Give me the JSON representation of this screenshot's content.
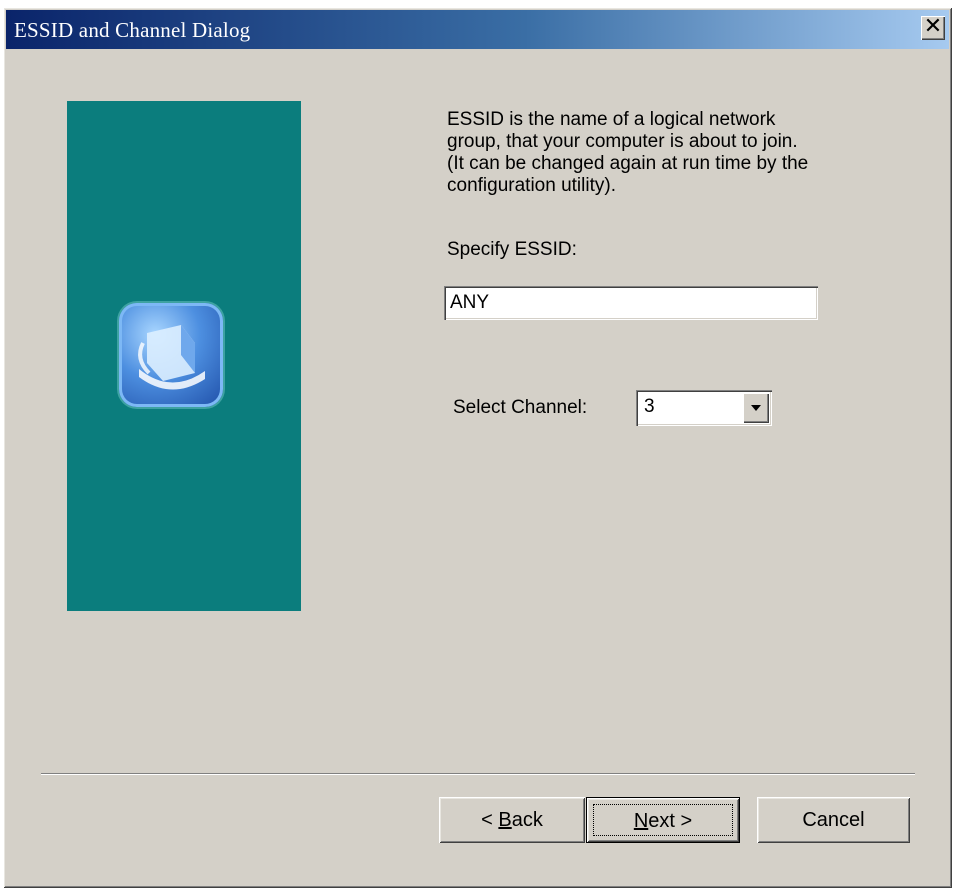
{
  "window": {
    "title": "ESSID and Channel Dialog",
    "close_label": "✕"
  },
  "description": "ESSID is the name of a logical network\ngroup, that your computer is about to join.\n(It can be changed again at run time by the\nconfiguration utility).",
  "essid": {
    "label": "Specify ESSID:",
    "value": "ANY"
  },
  "channel": {
    "label": "Select Channel:",
    "value": "3"
  },
  "buttons": {
    "back_prefix": "< ",
    "back_mnemonic": "B",
    "back_rest": "ack",
    "next_mnemonic": "N",
    "next_rest": "ext >",
    "cancel": "Cancel"
  },
  "icons": {
    "side_logo": "computer-network-icon",
    "dropdown": "chevron-down-icon",
    "close": "close-icon"
  },
  "colors": {
    "side_panel": "#0b7d7d",
    "titlebar_start": "#0a246a",
    "titlebar_end": "#a6caf0",
    "dialog_bg": "#d4d0c8"
  }
}
